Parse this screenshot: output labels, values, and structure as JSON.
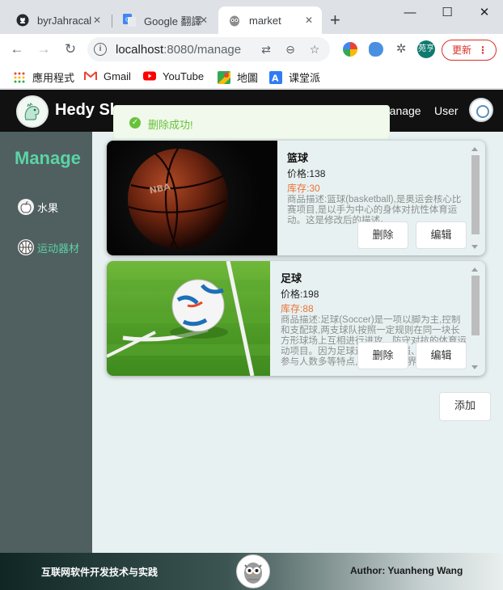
{
  "browser": {
    "tabs": [
      {
        "title": "byrJahracal",
        "icon": "github-icon",
        "active": false
      },
      {
        "title": "Google 翻譯",
        "icon": "google-translate-icon",
        "active": false
      },
      {
        "title": "market",
        "icon": "owl-favicon-icon",
        "active": true
      }
    ],
    "url_host": "localhost",
    "url_rest": ":8080/manage",
    "update_label": "更新",
    "profile_label": "苑亨",
    "bookmarks": [
      {
        "label": "應用程式",
        "icon": "apps-grid-icon"
      },
      {
        "label": "Gmail",
        "icon": "gmail-icon"
      },
      {
        "label": "YouTube",
        "icon": "youtube-icon"
      },
      {
        "label": "地圖",
        "icon": "maps-icon"
      },
      {
        "label": "课堂派",
        "icon": "ketangpai-icon"
      }
    ]
  },
  "header": {
    "brand": "Hedy Shop",
    "nav_manage": "Manage",
    "nav_user": "User"
  },
  "sidebar": {
    "title": "Manage",
    "items": [
      {
        "label": "水果",
        "icon": "apple-icon",
        "active": false
      },
      {
        "label": "运动器材",
        "icon": "basketball-icon",
        "active": true
      }
    ]
  },
  "toast": {
    "message": "删除成功!",
    "icon": "success-check-icon",
    "color": "#67c23a"
  },
  "products": [
    {
      "name": "篮球",
      "price_label": "价格:",
      "price": "138",
      "stock_label": "库存:",
      "stock": "30",
      "desc": "商品描述:篮球(basketball),是奥运会核心比赛项目,是以手为中心的身体对抗性体育运动。这是修改后的描述。",
      "delete_label": "删除",
      "edit_label": "编辑"
    },
    {
      "name": "足球",
      "price_label": "价格:",
      "price": "198",
      "stock_label": "库存:",
      "stock": "88",
      "desc": "商品描述:足球(Soccer)是一项以脚为主,控制和支配球,两支球队按照一定规则在同一块长方形球场上互相进行进攻、防守对抗的体育运动项目。因为足球运动对抗性强、战术多变、参与人数多等特点,故被称为\"世界第一运动\"。",
      "delete_label": "删除",
      "edit_label": "编辑"
    }
  ],
  "add_label": "添加",
  "footer": {
    "left": "互联网软件开发技术与实践",
    "right": "Author: Yuanheng Wang"
  },
  "colors": {
    "accent": "#5bd3a6",
    "stock": "#e8743b",
    "sidebar_bg": "#505f5f",
    "main_bg": "#e8f1f1",
    "header_bg": "#111111"
  }
}
